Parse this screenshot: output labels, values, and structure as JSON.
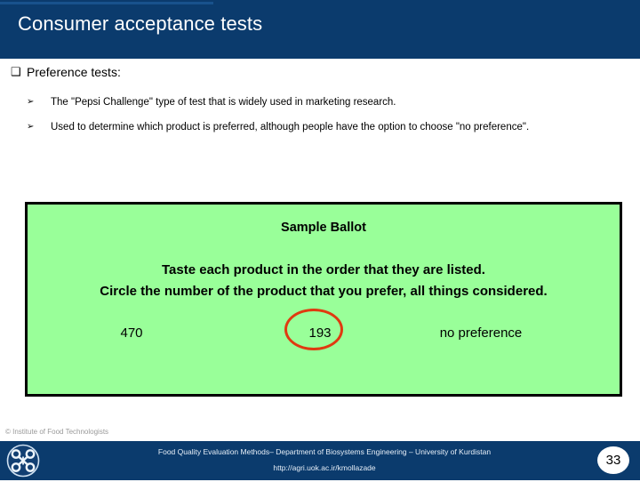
{
  "slide": {
    "title": "Consumer acceptance tests",
    "page_number": "33",
    "colors": {
      "header_bg": "#0b3b6d",
      "header_accent": "#18528c",
      "ballot_bg": "#99ff99",
      "ballot_border": "#000000",
      "circle_mark": "#e03a10",
      "credit_text": "#9a9a9a"
    }
  },
  "body": {
    "bullet1": {
      "marker": "hollow-square-bullet",
      "marker_glyph": "❑",
      "text": "Preference tests:"
    },
    "sub_bullets": [
      {
        "marker": "arrowhead-bullet",
        "marker_glyph": "➢",
        "text": "The \"Pepsi Challenge\" type of test that is widely used in marketing research."
      },
      {
        "marker": "arrowhead-bullet",
        "marker_glyph": "➢",
        "text": "Used to determine which product is preferred, although people have the option to choose \"no preference\"."
      }
    ]
  },
  "ballot": {
    "title": "Sample Ballot",
    "instruction_line_1": "Taste each product in the order that they are listed.",
    "instruction_line_2": "Circle the number of the product that you prefer, all things considered.",
    "options": [
      {
        "label": "470",
        "circled": false
      },
      {
        "label": "193",
        "circled": true
      },
      {
        "label": "no preference",
        "circled": false
      }
    ]
  },
  "credit": {
    "text": "© Institute of Food Technologists"
  },
  "footer": {
    "logo_name": "university-of-kurdistan-logo",
    "line1": "Food Quality Evaluation Methods– Department of Biosystems Engineering – University of Kurdistan",
    "line2": "http://agri.uok.ac.ir/kmollazade"
  }
}
